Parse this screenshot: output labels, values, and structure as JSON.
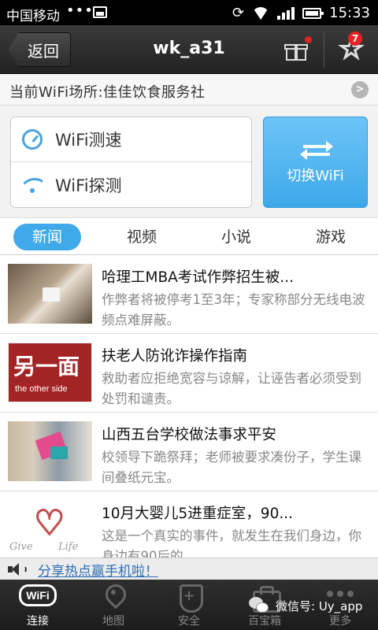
{
  "status_bar": {
    "carrier": "中国移动",
    "dots": "•••",
    "time": "15:33"
  },
  "titlebar": {
    "back_label": "返回",
    "title": "wk_a31",
    "favorites_badge": "7"
  },
  "placebar": {
    "text": "当前WiFi场所:佳佳饮食服务社"
  },
  "tools": {
    "speed_test": "WiFi测速",
    "probe": "WiFi探测",
    "switch": "切换WiFi"
  },
  "tabs": [
    {
      "label": "新闻",
      "active": true
    },
    {
      "label": "视频",
      "active": false
    },
    {
      "label": "小说",
      "active": false
    },
    {
      "label": "游戏",
      "active": false
    }
  ],
  "news": [
    {
      "title": "哈理工MBA考试作弊招生被...",
      "desc": "作弊者将被停考1至3年；专家称部分无线电波频点难屏蔽。",
      "thumb": "exam-device-photo"
    },
    {
      "title": "扶老人防讹诈操作指南",
      "desc": "救助者应拒绝宽容与谅解，让诬告者必须受到处罚和谴责。",
      "thumb_text": "另一面",
      "thumb_sub": "the other side"
    },
    {
      "title": "山西五台学校做法事求平安",
      "desc": "校领导下跪祭拜；老师被要求凑份子，学生课间叠纸元宝。",
      "thumb": "ritual-photo"
    },
    {
      "title": "10月大婴儿5进重症室，90...",
      "desc": "这是一个真实的事件，就发生在我们身边，你身边有90后的...",
      "thumb_left": "Give",
      "thumb_right": "Life"
    }
  ],
  "sharebar": {
    "link": "分享热点赢手机啦！"
  },
  "bottom_nav": [
    {
      "label": "连接",
      "icon": "wifi-icon",
      "active": true
    },
    {
      "label": "地图",
      "icon": "map-pin-icon",
      "active": false
    },
    {
      "label": "安全",
      "icon": "shield-icon",
      "active": false
    },
    {
      "label": "百宝箱",
      "icon": "toolbox-icon",
      "active": false
    },
    {
      "label": "更多",
      "icon": "more-icon",
      "active": false
    }
  ],
  "nav_wifi_text": "WiFi",
  "watermark": "微信号: Uy_app",
  "colors": {
    "accent": "#3fa9ea",
    "badge": "#e52222",
    "titlebar": "#2c2c2c"
  }
}
